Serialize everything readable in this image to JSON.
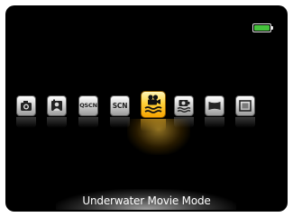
{
  "battery": {
    "level": 1.0,
    "color": "#45c23c"
  },
  "modes": [
    {
      "name": "camera-icon",
      "text": ""
    },
    {
      "name": "portrait-icon",
      "text": ""
    },
    {
      "name": "qscn",
      "text": "QSCN"
    },
    {
      "name": "scn",
      "text": "SCN"
    },
    {
      "name": "underwater-movie-icon",
      "text": "",
      "selected": true
    },
    {
      "name": "underwater-photo-icon",
      "text": ""
    },
    {
      "name": "panorama-icon",
      "text": ""
    },
    {
      "name": "frame-icon",
      "text": ""
    }
  ],
  "mode_label": "Underwater Movie Mode",
  "colors": {
    "accent": "#ffc21a",
    "background": "#000000"
  }
}
